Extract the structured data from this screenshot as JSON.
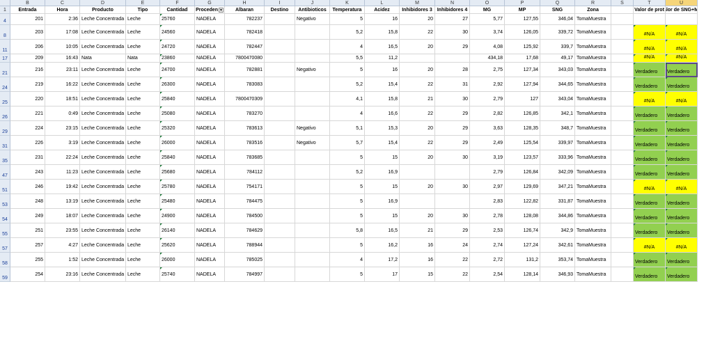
{
  "columns": [
    {
      "letter": "B",
      "title": "Entrada"
    },
    {
      "letter": "C",
      "title": "Hora"
    },
    {
      "letter": "D",
      "title": "Producto"
    },
    {
      "letter": "E",
      "title": "Tipo"
    },
    {
      "letter": "F",
      "title": "Cantidad"
    },
    {
      "letter": "G",
      "title": "Proceden"
    },
    {
      "letter": "H",
      "title": "Albaran"
    },
    {
      "letter": "I",
      "title": "Destino"
    },
    {
      "letter": "J",
      "title": "Antibioticos"
    },
    {
      "letter": "K",
      "title": "Temperatura"
    },
    {
      "letter": "L",
      "title": "Acidez"
    },
    {
      "letter": "M",
      "title": "Inhibidores 3"
    },
    {
      "letter": "N",
      "title": "Inhibidores 4"
    },
    {
      "letter": "O",
      "title": "MG"
    },
    {
      "letter": "P",
      "title": "MP"
    },
    {
      "letter": "Q",
      "title": "SNG"
    },
    {
      "letter": "R",
      "title": "Zona"
    },
    {
      "letter": "S",
      "title": ""
    },
    {
      "letter": "T",
      "title": "Valor de prot"
    },
    {
      "letter": "U",
      "title": "Valor de SNG+MG"
    }
  ],
  "header_row_number": "1",
  "rows": [
    {
      "n": "4",
      "c": [
        "201",
        "2:36",
        "Leche Concentrada",
        "Leche",
        "25760",
        "NADELA",
        "782237",
        "",
        "Negativo",
        "5",
        "16",
        "20",
        "27",
        "5,77",
        "127,55",
        "346,04",
        "TomaMuestra",
        "",
        "",
        ""
      ],
      "t": "none"
    },
    {
      "n": "8",
      "c": [
        "203",
        "17:08",
        "Leche Concentrada",
        "Leche",
        "24560",
        "NADELA",
        "782418",
        "",
        "",
        "5,2",
        "15,8",
        "22",
        "30",
        "3,74",
        "126,05",
        "339,72",
        "TomaMuestra",
        "",
        "#N/A",
        "#N/A"
      ],
      "t": "yellow"
    },
    {
      "n": "11",
      "c": [
        "206",
        "10:05",
        "Leche Concentrada",
        "Leche",
        "24720",
        "NADELA",
        "782447",
        "",
        "",
        "4",
        "16,5",
        "20",
        "29",
        "4,08",
        "125,92",
        "339,7",
        "TomaMuestra",
        "",
        "#N/A",
        "#N/A"
      ],
      "t": "yellow"
    },
    {
      "n": "17",
      "c": [
        "209",
        "16:43",
        "Nata",
        "Nata",
        "23860",
        "NADELA",
        "7800470080",
        "",
        "",
        "5,5",
        "11,2",
        "",
        "",
        "434,18",
        "17,68",
        "49,17",
        "TomaMuestra",
        "",
        "#N/A",
        "#N/A"
      ],
      "t": "yellow"
    },
    {
      "n": "21",
      "c": [
        "216",
        "23:11",
        "Leche Concentrada",
        "Leche",
        "24700",
        "NADELA",
        "782881",
        "",
        "Negativo",
        "5",
        "16",
        "20",
        "28",
        "2,75",
        "127,34",
        "343,03",
        "TomaMuestra",
        "",
        "Verdadero",
        "Verdadero"
      ],
      "t": "green"
    },
    {
      "n": "24",
      "c": [
        "219",
        "16:22",
        "Leche Concentrada",
        "Leche",
        "26300",
        "NADELA",
        "783083",
        "",
        "",
        "5,2",
        "15,4",
        "22",
        "31",
        "2,92",
        "127,94",
        "344,65",
        "TomaMuestra",
        "",
        "Verdadero",
        "Verdadero"
      ],
      "t": "green"
    },
    {
      "n": "25",
      "c": [
        "220",
        "18:51",
        "Leche Concentrada",
        "Leche",
        "25840",
        "NADELA",
        "7800470309",
        "",
        "",
        "4,1",
        "15,8",
        "21",
        "30",
        "2,79",
        "127",
        "343,04",
        "TomaMuestra",
        "",
        "#N/A",
        "#N/A"
      ],
      "t": "yellow"
    },
    {
      "n": "26",
      "c": [
        "221",
        "0:49",
        "Leche Concentrada",
        "Leche",
        "25080",
        "NADELA",
        "783270",
        "",
        "",
        "4",
        "16,6",
        "22",
        "29",
        "2,82",
        "126,85",
        "342,1",
        "TomaMuestra",
        "",
        "Verdadero",
        "Verdadero"
      ],
      "t": "green"
    },
    {
      "n": "29",
      "c": [
        "224",
        "23:15",
        "Leche Concentrada",
        "Leche",
        "25320",
        "NADELA",
        "783613",
        "",
        "Negativo",
        "5,1",
        "15,3",
        "20",
        "29",
        "3,63",
        "128,35",
        "348,7",
        "TomaMuestra",
        "",
        "Verdadero",
        "Verdadero"
      ],
      "t": "green"
    },
    {
      "n": "31",
      "c": [
        "226",
        "3:19",
        "Leche Concentrada",
        "Leche",
        "26000",
        "NADELA",
        "783516",
        "",
        "Negativo",
        "5,7",
        "15,4",
        "22",
        "29",
        "2,49",
        "125,54",
        "339,97",
        "TomaMuestra",
        "",
        "Verdadero",
        "Verdadero"
      ],
      "t": "green"
    },
    {
      "n": "35",
      "c": [
        "231",
        "22:24",
        "Leche Concentrada",
        "Leche",
        "25840",
        "NADELA",
        "783685",
        "",
        "",
        "5",
        "15",
        "20",
        "30",
        "3,19",
        "123,57",
        "333,96",
        "TomaMuestra",
        "",
        "Verdadero",
        "Verdadero"
      ],
      "t": "green"
    },
    {
      "n": "47",
      "c": [
        "243",
        "11:23",
        "Leche Concentrada",
        "Leche",
        "25680",
        "NADELA",
        "784112",
        "",
        "",
        "5,2",
        "16,9",
        "",
        "",
        "2,79",
        "126,84",
        "342,09",
        "TomaMuestra",
        "",
        "Verdadero",
        "Verdadero"
      ],
      "t": "green"
    },
    {
      "n": "51",
      "c": [
        "246",
        "19:42",
        "Leche Concentrada",
        "Leche",
        "25780",
        "NADELA",
        "754171",
        "",
        "",
        "5",
        "15",
        "20",
        "30",
        "2,97",
        "129,69",
        "347,21",
        "TomaMuestra",
        "",
        "#N/A",
        "#N/A"
      ],
      "t": "yellow"
    },
    {
      "n": "53",
      "c": [
        "248",
        "13:19",
        "Leche Concentrada",
        "Leche",
        "25480",
        "NADELA",
        "784475",
        "",
        "",
        "5",
        "16,9",
        "",
        "",
        "2,83",
        "122,82",
        "331,87",
        "TomaMuestra",
        "",
        "Verdadero",
        "Verdadero"
      ],
      "t": "green"
    },
    {
      "n": "54",
      "c": [
        "249",
        "18:07",
        "Leche Concentrada",
        "Leche",
        "24900",
        "NADELA",
        "784500",
        "",
        "",
        "5",
        "15",
        "20",
        "30",
        "2,78",
        "128,08",
        "344,86",
        "TomaMuestra",
        "",
        "Verdadero",
        "Verdadero"
      ],
      "t": "green"
    },
    {
      "n": "55",
      "c": [
        "251",
        "23:55",
        "Leche Concentrada",
        "Leche",
        "26140",
        "NADELA",
        "784629",
        "",
        "",
        "5,8",
        "16,5",
        "21",
        "29",
        "2,53",
        "126,74",
        "342,9",
        "TomaMuestra",
        "",
        "Verdadero",
        "Verdadero"
      ],
      "t": "green"
    },
    {
      "n": "57",
      "c": [
        "257",
        "4:27",
        "Leche Concentrada",
        "Leche",
        "25620",
        "NADELA",
        "788944",
        "",
        "",
        "5",
        "16,2",
        "16",
        "24",
        "2,74",
        "127,24",
        "342,61",
        "TomaMuestra",
        "",
        "#N/A",
        "#N/A"
      ],
      "t": "yellow"
    },
    {
      "n": "58",
      "c": [
        "255",
        "1:52",
        "Leche Concentrada",
        "Leche",
        "26000",
        "NADELA",
        "785025",
        "",
        "",
        "4",
        "17,2",
        "16",
        "22",
        "2,72",
        "131,2",
        "353,74",
        "TomaMuestra",
        "",
        "Verdadero",
        "Verdadero"
      ],
      "t": "green"
    },
    {
      "n": "59",
      "c": [
        "254",
        "23:16",
        "Leche Concentrada",
        "Leche",
        "25740",
        "NADELA",
        "784997",
        "",
        "",
        "5",
        "17",
        "15",
        "22",
        "2,54",
        "128,14",
        "346,93",
        "TomaMuestra",
        "",
        "Verdadero",
        "Verdadero"
      ],
      "t": "green"
    }
  ]
}
